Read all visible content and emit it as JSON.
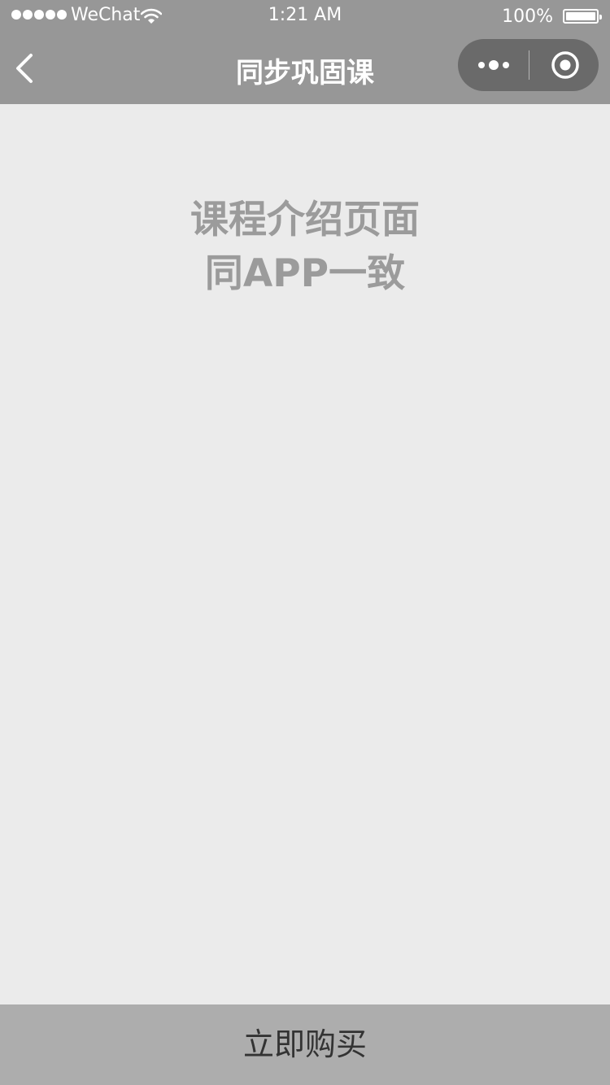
{
  "status_bar": {
    "carrier": "WeChat",
    "time": "1:21 AM",
    "battery": "100%"
  },
  "navbar": {
    "title": "同步巩固课"
  },
  "content": {
    "line1": "课程介绍页面",
    "line2": "同APP一致"
  },
  "footer": {
    "buy_label": "立即购买"
  },
  "colors": {
    "topbar": "#979797",
    "background": "#ebebeb",
    "capsule": "#6a6a6a",
    "buy_button": "#adadad"
  },
  "icons": [
    "signal-dots-icon",
    "wifi-icon",
    "battery-icon",
    "back-arrow-icon",
    "more-dots-icon",
    "close-target-icon"
  ]
}
